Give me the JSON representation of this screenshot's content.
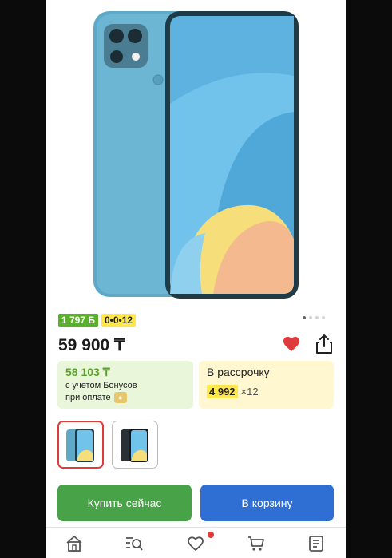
{
  "product": {
    "bonus_badge": "1 797 Б",
    "installment_badge": "0•0•12",
    "price": "59 900 ₸",
    "bonus_card": {
      "price": "58 103 ₸",
      "line1": "с учетом Бонусов",
      "line2": "при оплате"
    },
    "installment_card": {
      "title": "В рассрочку",
      "amount": "4 992",
      "months": "×12"
    },
    "image_dots": 4,
    "active_dot": 0
  },
  "actions": {
    "buy_now": "Купить сейчас",
    "add_to_cart": "В корзину"
  },
  "nav": {
    "items": [
      "home-icon",
      "catalog-search-icon",
      "heart-icon",
      "cart-icon",
      "orders-icon"
    ]
  },
  "colors": {
    "bonus_green": "#59b12a",
    "installment_yellow": "#ffe94a",
    "buy_green": "#48a247",
    "cart_blue": "#2f6ed2",
    "heart_red": "#e03b3b"
  }
}
